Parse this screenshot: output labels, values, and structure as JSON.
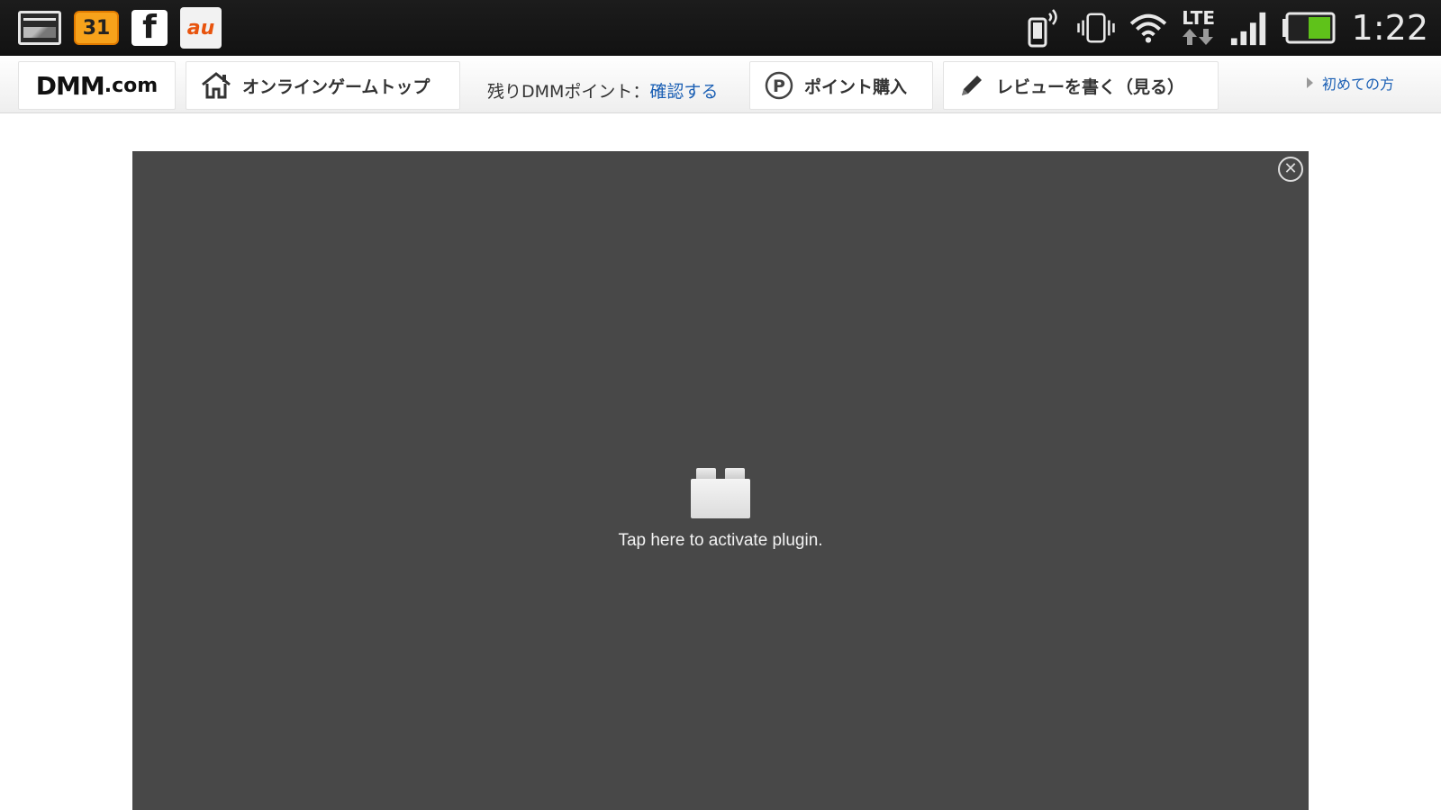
{
  "status_bar": {
    "notifications": [
      {
        "icon": "gallery-icon"
      },
      {
        "icon": "calendar-icon",
        "label": "31"
      },
      {
        "icon": "facebook-icon",
        "label": "f"
      },
      {
        "icon": "au-icon",
        "label": "au"
      }
    ],
    "network": {
      "lte_label": "LTE"
    },
    "clock": "1:22",
    "battery_color": "#5fc21a"
  },
  "header": {
    "logo": {
      "main": "DMM",
      "suffix": ".com"
    },
    "home_label": "オンラインゲームトップ",
    "points_label": "残りDMMポイント：",
    "points_link": "確認する",
    "buy_label": "ポイント購入",
    "review_label": "レビューを書く（見る）",
    "first_time_label": "初めての方",
    "link_color": "#1a5fb4"
  },
  "plugin": {
    "message": "Tap here to activate plugin.",
    "close_symbol": "✕",
    "background": "#484848"
  }
}
